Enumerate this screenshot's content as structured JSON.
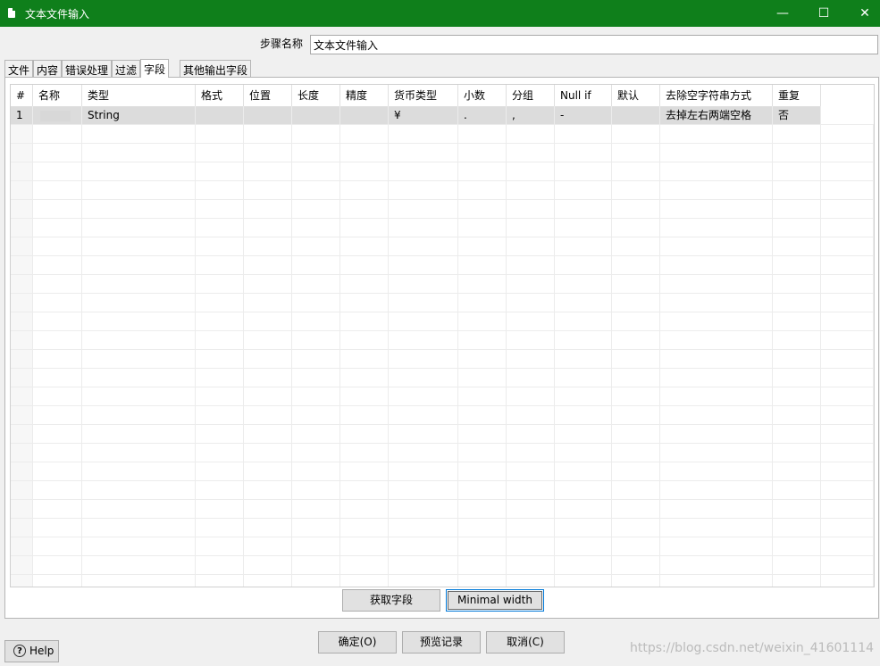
{
  "window": {
    "title": "文本文件输入",
    "minimize": "—",
    "maximize": "☐",
    "close": "✕"
  },
  "step": {
    "label": "步骤名称",
    "value": "文本文件输入"
  },
  "tabs": [
    {
      "label": "文件"
    },
    {
      "label": "内容"
    },
    {
      "label": "错误处理"
    },
    {
      "label": "过滤"
    },
    {
      "label": "字段"
    },
    {
      "label": "其他输出字段"
    }
  ],
  "grid": {
    "sort_indicator": "^",
    "headers": [
      "#",
      "名称",
      "类型",
      "格式",
      "位置",
      "长度",
      "精度",
      "货币类型",
      "小数",
      "分组",
      "Null if",
      "默认",
      "去除空字符串方式",
      "重复"
    ],
    "rows": [
      {
        "num": "1",
        "name": "",
        "type": "String",
        "format": "",
        "position": "",
        "length": "",
        "precision": "",
        "currency": "¥",
        "decimal": ".",
        "group": ",",
        "nullif": "-",
        "default": "",
        "trim": "去掉左右两端空格",
        "repeat": "否"
      }
    ]
  },
  "buttons": {
    "get_fields": "获取字段",
    "minimal_width": "Minimal width",
    "ok": "确定(O)",
    "preview": "预览记录",
    "cancel": "取消(C)",
    "help": "Help"
  },
  "watermark": "https://blog.csdn.net/weixin_41601114",
  "colors": {
    "titlebar": "#0f7f1b",
    "selected_row": "#dcdcdc"
  }
}
